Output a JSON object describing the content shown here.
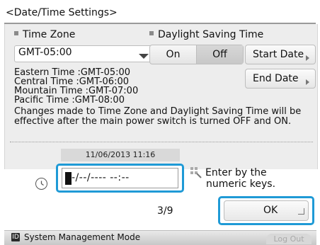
{
  "title": "<Date/Time Settings>",
  "time_zone": {
    "label": "Time Zone",
    "selected": "GMT-05:00",
    "info_lines": [
      "Eastern Time :GMT-05:00",
      "Central Time :GMT-06:00",
      "Mountain Time :GMT-07:00",
      "Pacific Time :GMT-08:00"
    ]
  },
  "dst": {
    "label": "Daylight Saving Time",
    "on_label": "On",
    "off_label": "Off",
    "selected": "Off",
    "start_date_label": "Start Date",
    "end_date_label": "End Date"
  },
  "notice": [
    "Changes made to Time Zone and Daylight Saving Time will be",
    "effective after the main power switch is turned OFF and ON."
  ],
  "current_datetime": "11/06/2013 11:16",
  "datetime_input": "-/--/---- --:--",
  "hint": [
    "Enter by the",
    "numeric keys."
  ],
  "page_indicator": "3/9",
  "ok_label": "OK",
  "status_bar": {
    "mode_icon": "ID",
    "mode_text": "System Management Mode",
    "logout_label": "Log Out"
  },
  "colors": {
    "highlight": "#1f9ad6",
    "panel_bg": "#ededed"
  },
  "icons": {
    "clock": "clock-icon",
    "keys": "numeric-keys-icon",
    "dropdown": "chevron-down-icon"
  }
}
